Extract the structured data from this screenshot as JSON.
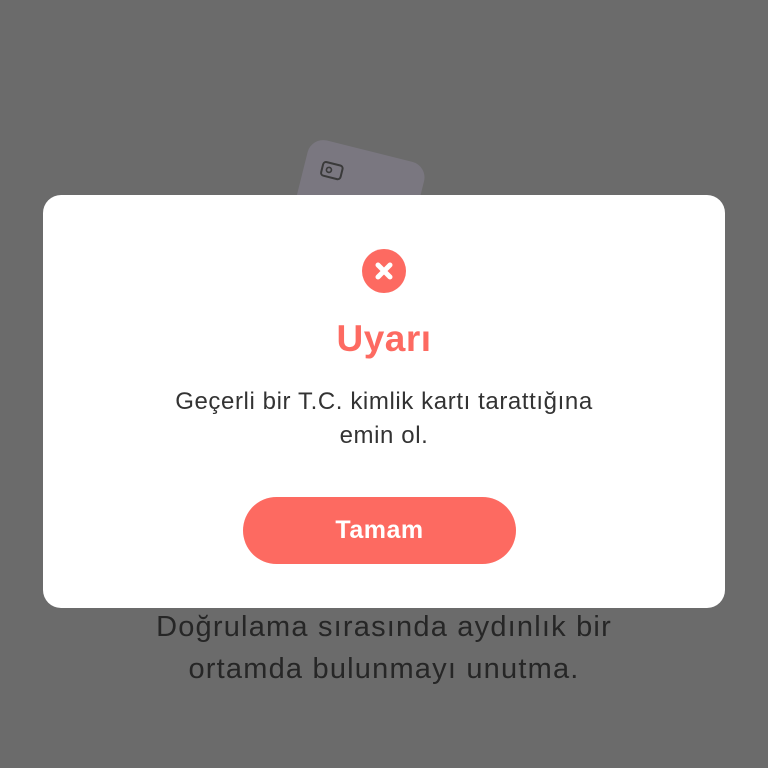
{
  "colors": {
    "overlay": "#6b6b6b",
    "accent": "#fd6a61",
    "dialog_background": "#ffffff",
    "message_text": "#333333"
  },
  "background": {
    "card_icon": "id-card-icon",
    "hint_line_1": "Doğrulama sırasında aydınlık bir",
    "hint_line_2": "ortamda bulunmayı unutma."
  },
  "dialog": {
    "icon": "error-x-icon",
    "title": "Uyarı",
    "message_line_1": "Geçerli bir T.C. kimlik kartı tarattığına",
    "message_line_2": "emin ol.",
    "ok_label": "Tamam"
  }
}
